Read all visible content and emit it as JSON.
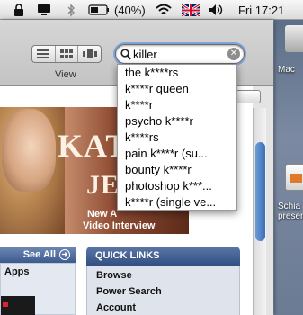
{
  "menubar": {
    "battery_text": "(40%)",
    "clock": "Fri 17:21"
  },
  "toolbar": {
    "view_label": "View"
  },
  "search": {
    "query": "killer",
    "suggestions": [
      "the k****rs",
      "k****r queen",
      "k****r",
      "psycho k****r",
      "k****rs",
      "pain k****r (su...",
      "bounty k****r",
      "photoshop k***...",
      "k****r (single ve..."
    ]
  },
  "banner": {
    "title_line1": "KATH",
    "title_line2": "JEN",
    "caption_line1": "New A",
    "caption_line2": "Video Interview"
  },
  "sections": {
    "see_all": "See All",
    "apps": "Apps",
    "quick_links_title": "QUICK LINKS",
    "quick_links": [
      "Browse",
      "Power Search",
      "Account"
    ]
  },
  "desktop": {
    "icon1_label": "Mac",
    "icon2_label_line1": "Schia",
    "icon2_label_line2": "present"
  },
  "colors": {
    "accent": "#3b6fb8",
    "quick_links_header": "#2f4d82",
    "flag_red": "#c8102e",
    "flag_blue": "#012169"
  }
}
